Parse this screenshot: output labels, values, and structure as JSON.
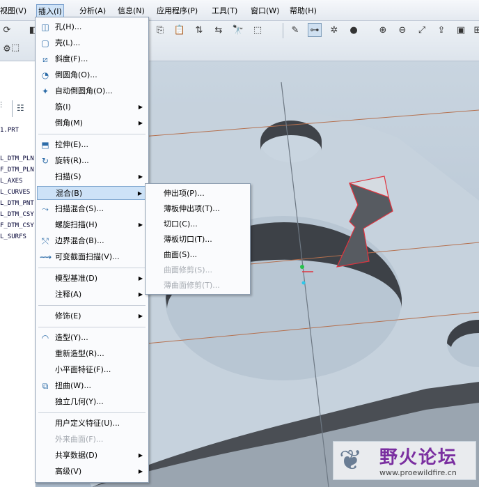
{
  "menubar": {
    "items": [
      {
        "label": "视图(V)"
      },
      {
        "label": "插入(I)"
      },
      {
        "label": "分析(A)"
      },
      {
        "label": "信息(N)"
      },
      {
        "label": "应用程序(P)"
      },
      {
        "label": "工具(T)"
      },
      {
        "label": "窗口(W)"
      },
      {
        "label": "帮助(H)"
      }
    ]
  },
  "model_tree": {
    "file": "1.PRT",
    "items": [
      "L_DTM_PLN",
      "F_DTM_PLN",
      "L_AXES",
      "L_CURVES",
      "L_DTM_PNT",
      "L_DTM_CSY",
      "F_DTM_CSY",
      "L_SURFS"
    ]
  },
  "insert_menu": {
    "items": [
      {
        "label": "孔(H)...",
        "icon": "hole-icon"
      },
      {
        "label": "壳(L)...",
        "icon": "shell-icon"
      },
      {
        "label": "斜度(F)...",
        "icon": "draft-icon"
      },
      {
        "label": "倒圆角(O)...",
        "icon": "round-icon"
      },
      {
        "label": "自动倒圆角(O)...",
        "icon": "auto-round-icon"
      },
      {
        "label": "筋(I)",
        "submenu": true
      },
      {
        "label": "倒角(M)",
        "submenu": true
      },
      {
        "label": "拉伸(E)...",
        "icon": "extrude-icon"
      },
      {
        "label": "旋转(R)...",
        "icon": "revolve-icon"
      },
      {
        "label": "扫描(S)",
        "submenu": true
      },
      {
        "label": "混合(B)",
        "submenu": true,
        "highlighted": true
      },
      {
        "label": "扫描混合(S)...",
        "icon": "swept-blend-icon"
      },
      {
        "label": "螺旋扫描(H)",
        "submenu": true
      },
      {
        "label": "边界混合(B)...",
        "icon": "boundary-blend-icon"
      },
      {
        "label": "可变截面扫描(V)...",
        "icon": "variable-section-sweep-icon"
      },
      {
        "label": "模型基准(D)",
        "submenu": true
      },
      {
        "label": "注释(A)",
        "submenu": true
      },
      {
        "label": "修饰(E)",
        "submenu": true
      },
      {
        "label": "造型(Y)...",
        "icon": "style-icon"
      },
      {
        "label": "重新造型(R)..."
      },
      {
        "label": "小平面特征(F)..."
      },
      {
        "label": "扭曲(W)...",
        "icon": "warp-icon"
      },
      {
        "label": "独立几何(Y)..."
      },
      {
        "label": "用户定义特征(U)..."
      },
      {
        "label": "外来曲面(F)...",
        "disabled": true
      },
      {
        "label": "共享数据(D)",
        "submenu": true
      },
      {
        "label": "高级(V)",
        "submenu": true
      }
    ]
  },
  "blend_submenu": {
    "items": [
      {
        "label": "伸出项(P)..."
      },
      {
        "label": "薄板伸出项(T)..."
      },
      {
        "label": "切口(C)..."
      },
      {
        "label": "薄板切口(T)..."
      },
      {
        "label": "曲面(S)..."
      },
      {
        "label": "曲面修剪(S)...",
        "disabled": true
      },
      {
        "label": "薄曲面修剪(T)...",
        "disabled": true
      }
    ]
  },
  "watermark": {
    "title": "野火论坛",
    "url": "www.proewildfire.cn"
  },
  "colors": {
    "menu_highlight": "#cde2f7",
    "part_surface": "#c6d2dd",
    "part_wall": "#4a4e54",
    "datum_line": "#b5704e",
    "blend_feature_edge": "#e0343f"
  }
}
